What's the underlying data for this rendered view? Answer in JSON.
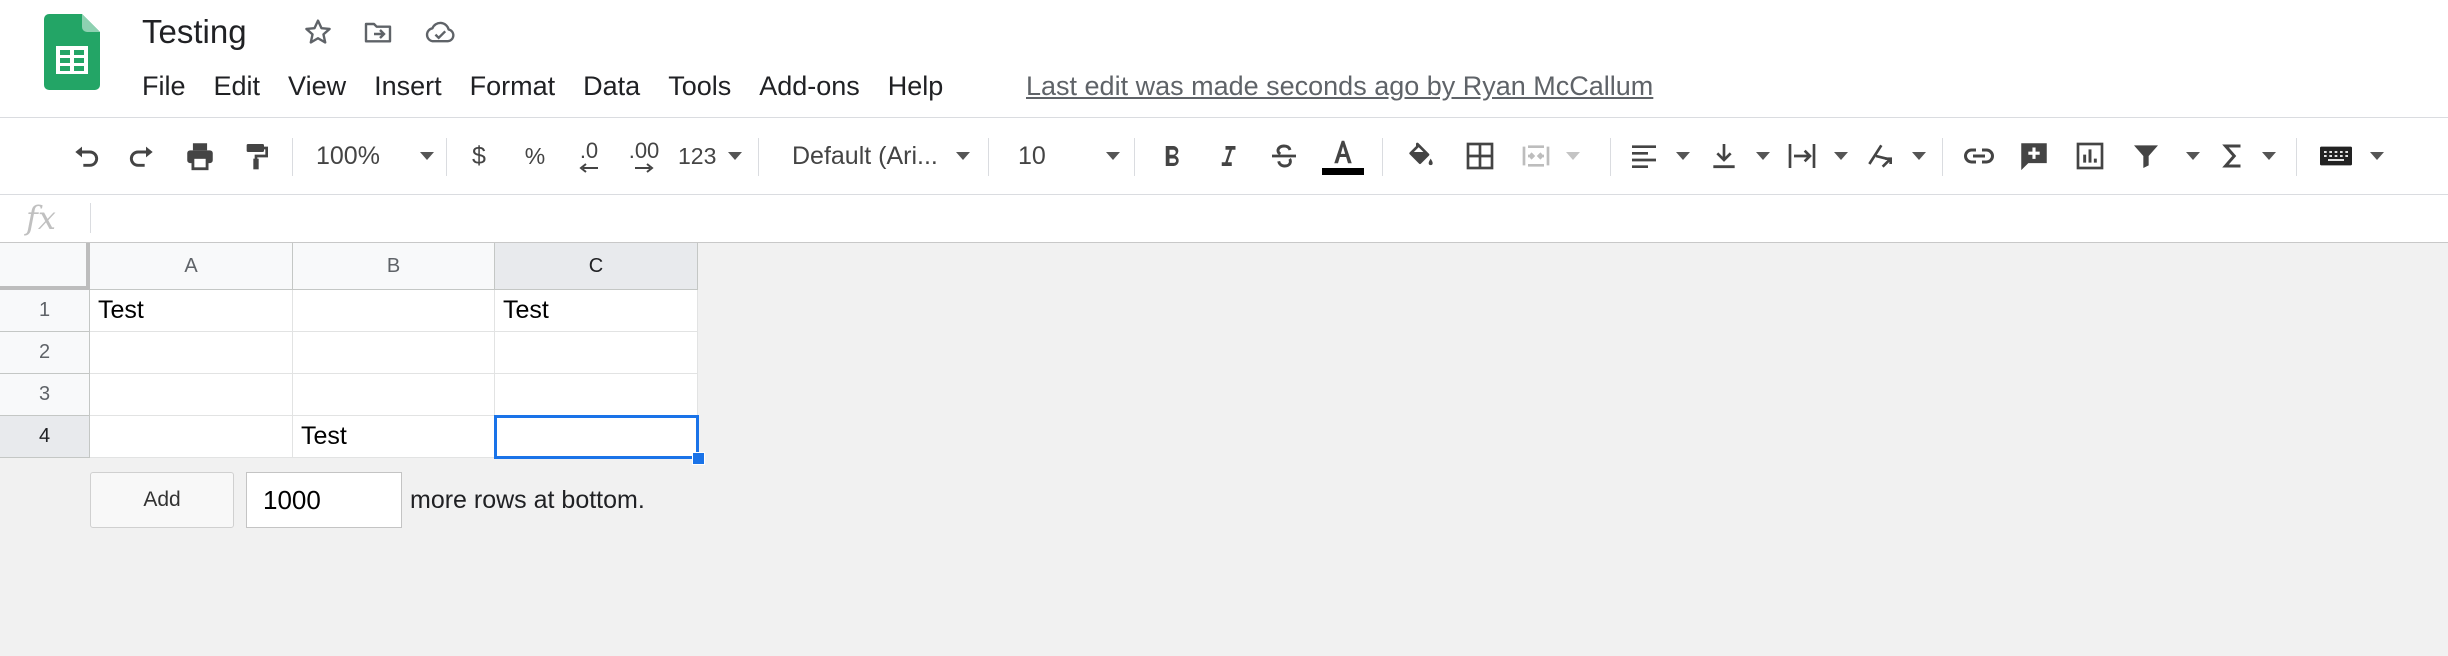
{
  "doc": {
    "title": "Testing",
    "last_edit": "Last edit was made seconds ago by Ryan McCallum"
  },
  "menu": [
    "File",
    "Edit",
    "View",
    "Insert",
    "Format",
    "Data",
    "Tools",
    "Add-ons",
    "Help"
  ],
  "toolbar": {
    "zoom": "100%",
    "currency": "$",
    "percent": "%",
    "dec_less": ".0",
    "dec_more": ".00",
    "more_formats": "123",
    "font": "Default (Ari...",
    "font_size": "10",
    "text_color": "#000000"
  },
  "formula_bar": {
    "fx": "fx",
    "value": ""
  },
  "grid": {
    "columns": [
      "A",
      "B",
      "C"
    ],
    "rows": [
      "1",
      "2",
      "3",
      "4"
    ],
    "cells": [
      [
        "Test",
        "",
        "Test"
      ],
      [
        "",
        "",
        ""
      ],
      [
        "",
        "",
        ""
      ],
      [
        "",
        "Test",
        ""
      ]
    ],
    "active_cell": "C4"
  },
  "add_rows": {
    "button": "Add",
    "count": "1000",
    "label": "more rows at bottom."
  },
  "colors": {
    "accent": "#1a73e8",
    "sheets_green": "#23a566"
  }
}
